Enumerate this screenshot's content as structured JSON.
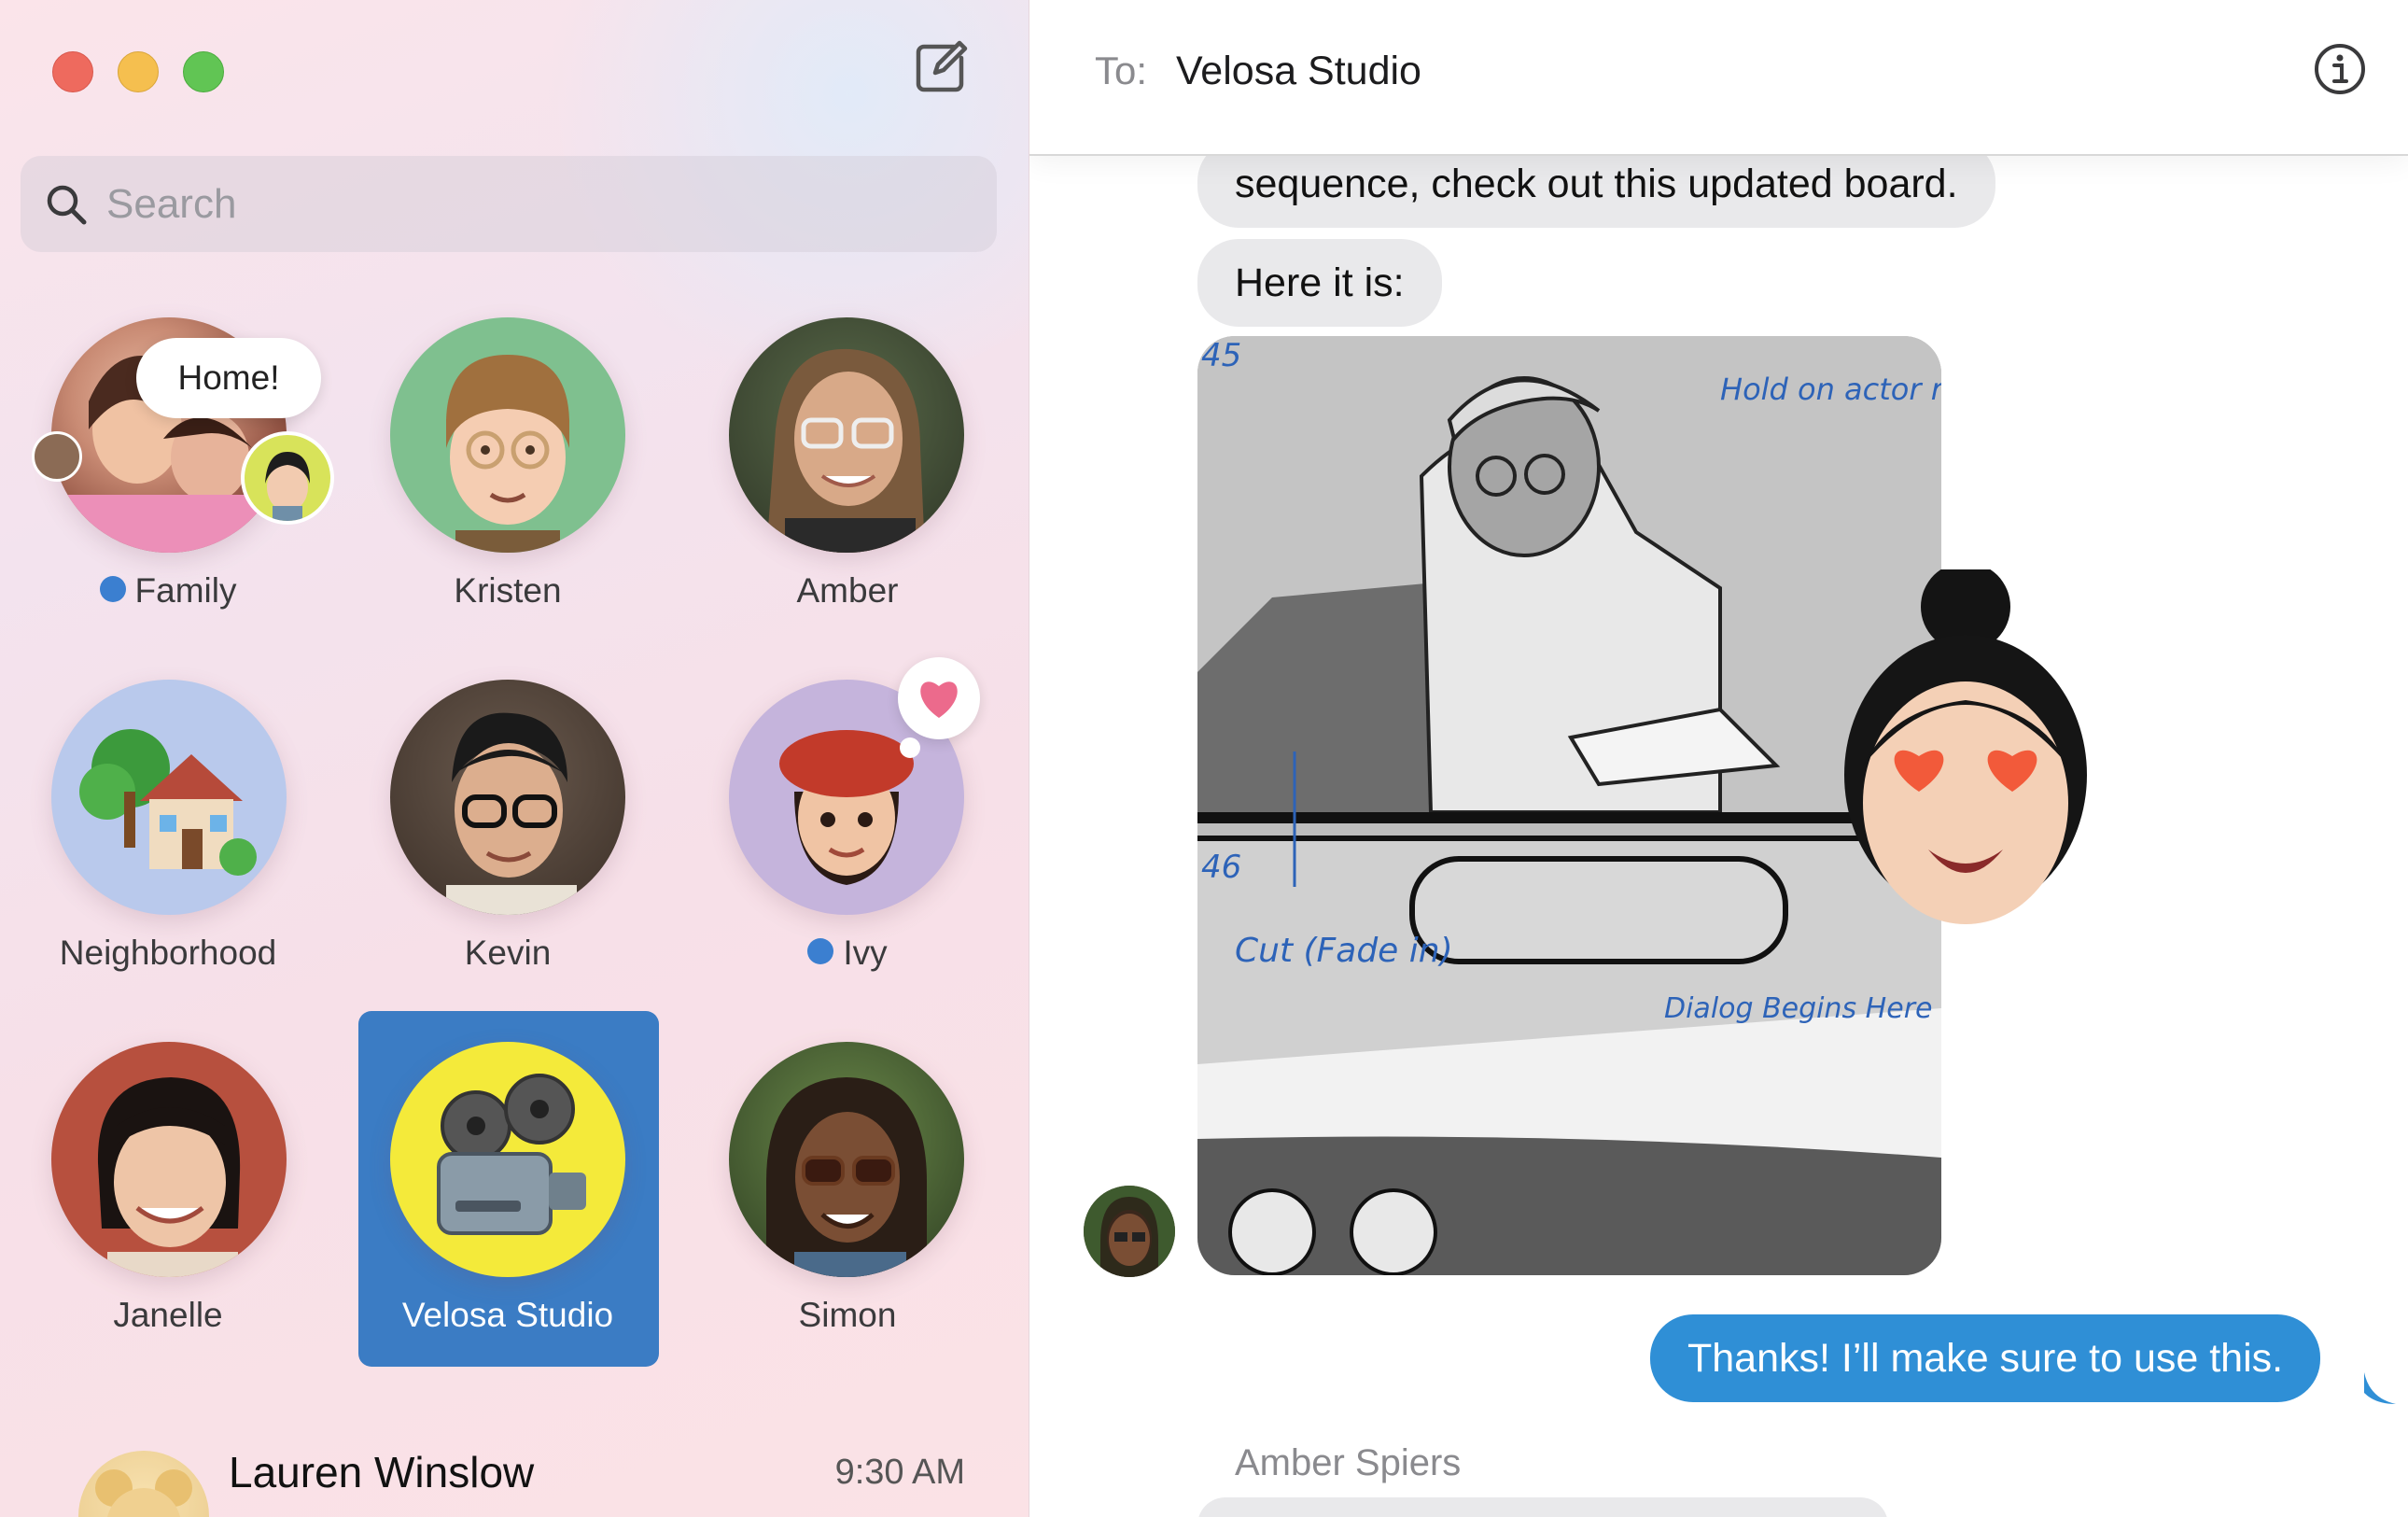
{
  "window": {
    "traffic_lights": [
      "close",
      "minimize",
      "zoom"
    ],
    "compose_icon": "compose-icon"
  },
  "search": {
    "placeholder": "Search",
    "value": ""
  },
  "pinned": [
    {
      "label": "Family",
      "unread": true,
      "bubble": "Home!"
    },
    {
      "label": "Kristen",
      "unread": false
    },
    {
      "label": "Amber",
      "unread": false
    },
    {
      "label": "Neighborhood",
      "unread": false
    },
    {
      "label": "Kevin",
      "unread": false
    },
    {
      "label": "Ivy",
      "unread": true,
      "reaction": "heart"
    },
    {
      "label": "Janelle",
      "unread": false
    },
    {
      "label": "Velosa Studio",
      "unread": false,
      "selected": true
    },
    {
      "label": "Simon",
      "unread": false
    }
  ],
  "conversations": [
    {
      "name": "Lauren Winslow",
      "time": "9:30 AM"
    }
  ],
  "chat": {
    "to_label": "To:",
    "recipient": "Velosa Studio",
    "messages": [
      {
        "direction": "in",
        "text": "sequence, check out this updated board."
      },
      {
        "direction": "in",
        "text": "Here it is:"
      },
      {
        "direction": "in",
        "type": "image",
        "annotations": [
          "45",
          "Hold on actor reading",
          "46",
          "Cut (Fade in)",
          "Dialog Begins Here"
        ]
      },
      {
        "direction": "out",
        "text": "Thanks! I’ll make sure to use this."
      }
    ],
    "next_sender": "Amber Spiers"
  },
  "colors": {
    "accent": "#3b7cc4",
    "outgoing_bubble": "#2f8fd6",
    "incoming_bubble": "#e9e9eb",
    "unread_dot": "#3b7fd0"
  }
}
